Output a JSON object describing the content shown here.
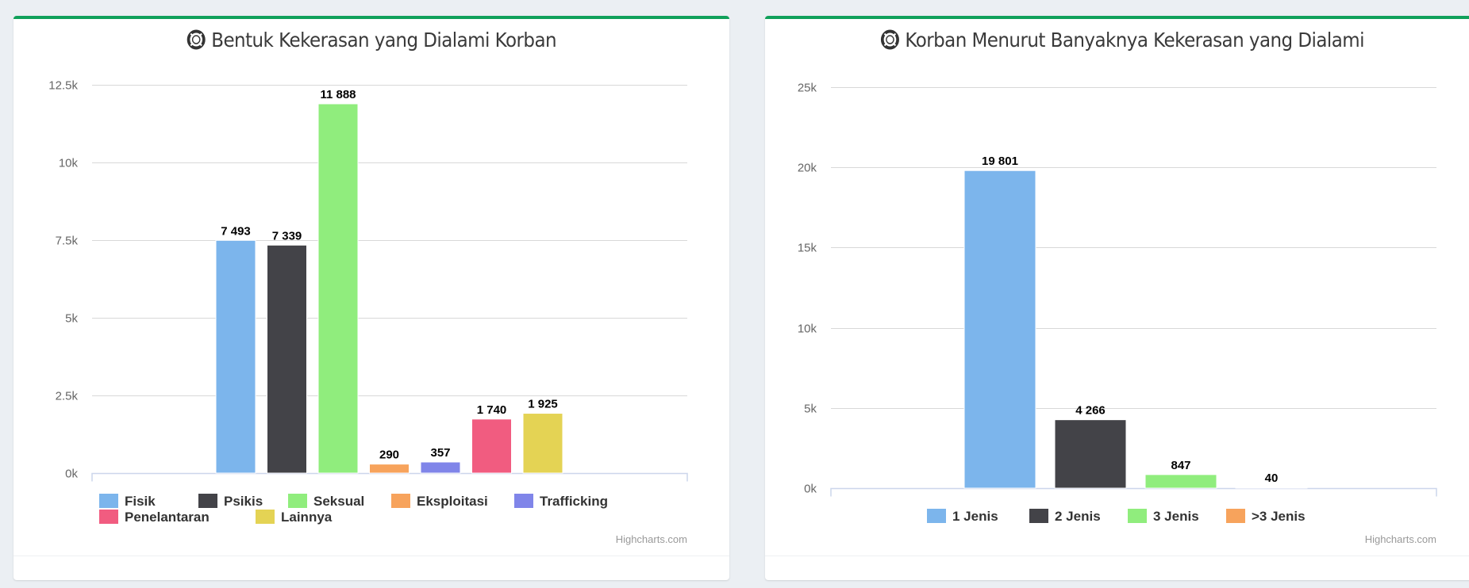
{
  "cards": [
    {
      "title": "Bentuk Kekerasan yang Dialami Korban",
      "icon": "life-ring-icon",
      "credits": "Highcharts.com"
    },
    {
      "title": "Korban Menurut Banyaknya Kekerasan yang Dialami",
      "icon": "life-ring-icon",
      "credits": "Highcharts.com"
    }
  ],
  "chart_data": [
    {
      "type": "bar",
      "title": "Bentuk Kekerasan yang Dialami Korban",
      "xlabel": "",
      "ylabel": "",
      "ylim": [
        0,
        12500
      ],
      "yticks": [
        0,
        2500,
        5000,
        7500,
        10000,
        12500
      ],
      "ytick_labels": [
        "0k",
        "2.5k",
        "5k",
        "7.5k",
        "10k",
        "12.5k"
      ],
      "grid": true,
      "legend_position": "bottom-center",
      "series": [
        {
          "name": "Fisik",
          "value": 7493,
          "label": "7 493",
          "color": "#7cb5ec"
        },
        {
          "name": "Psikis",
          "value": 7339,
          "label": "7 339",
          "color": "#434348"
        },
        {
          "name": "Seksual",
          "value": 11888,
          "label": "11 888",
          "color": "#90ed7d"
        },
        {
          "name": "Eksploitasi",
          "value": 290,
          "label": "290",
          "color": "#f7a35c"
        },
        {
          "name": "Trafficking",
          "value": 357,
          "label": "357",
          "color": "#8085e9"
        },
        {
          "name": "Penelantaran",
          "value": 1740,
          "label": "1 740",
          "color": "#f15c80"
        },
        {
          "name": "Lainnya",
          "value": 1925,
          "label": "1 925",
          "color": "#e4d354"
        }
      ]
    },
    {
      "type": "bar",
      "title": "Korban Menurut Banyaknya Kekerasan yang Dialami",
      "xlabel": "",
      "ylabel": "",
      "ylim": [
        0,
        25000
      ],
      "yticks": [
        0,
        5000,
        10000,
        15000,
        20000,
        25000
      ],
      "ytick_labels": [
        "0k",
        "5k",
        "10k",
        "15k",
        "20k",
        "25k"
      ],
      "grid": true,
      "legend_position": "bottom-center",
      "series": [
        {
          "name": "1 Jenis",
          "value": 19801,
          "label": "19 801",
          "color": "#7cb5ec"
        },
        {
          "name": "2 Jenis",
          "value": 4266,
          "label": "4 266",
          "color": "#434348"
        },
        {
          "name": "3 Jenis",
          "value": 847,
          "label": "847",
          "color": "#90ed7d"
        },
        {
          "name": ">3 Jenis",
          "value": 40,
          "label": "40",
          "color": "#f7a35c"
        }
      ]
    }
  ]
}
